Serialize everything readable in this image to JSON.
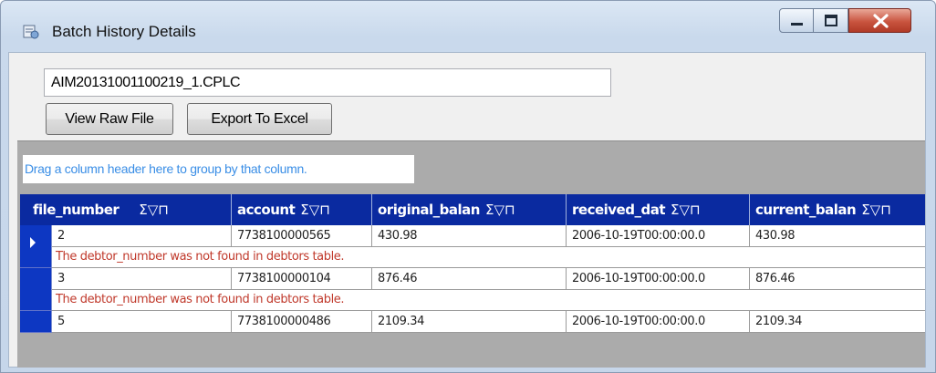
{
  "window": {
    "title": "Batch History Details",
    "icon": "batch-history-icon"
  },
  "file": {
    "name": "AIM20131001100219_1.CPLC"
  },
  "buttons": {
    "view_raw": "View Raw File",
    "export": "Export To Excel"
  },
  "grid": {
    "group_hint": "Drag a column header here to group by that column.",
    "column_icons": "Σ▽⊓",
    "columns": [
      {
        "label": "file_number"
      },
      {
        "label": "account"
      },
      {
        "label": "original_balan"
      },
      {
        "label": "received_dat"
      },
      {
        "label": "current_balan"
      }
    ],
    "rows": [
      {
        "cells": [
          "2",
          "7738100000565",
          "430.98",
          "2006-10-19T00:00:00.0",
          "430.98"
        ],
        "error": "The debtor_number was not found in debtors table.",
        "selected": true
      },
      {
        "cells": [
          "3",
          "7738100000104",
          "876.46",
          "2006-10-19T00:00:00.0",
          "876.46"
        ],
        "error": "The debtor_number was not found in debtors table.",
        "selected": false
      },
      {
        "cells": [
          "5",
          "7738100000486",
          "2109.34",
          "2006-10-19T00:00:00.0",
          "2109.34"
        ],
        "error": "",
        "selected": false
      }
    ]
  },
  "colors": {
    "header_bg": "#0a2aa0",
    "row_indicator": "#0d37c2",
    "error_text": "#c0392b",
    "group_hint_text": "#3a8ee6"
  }
}
